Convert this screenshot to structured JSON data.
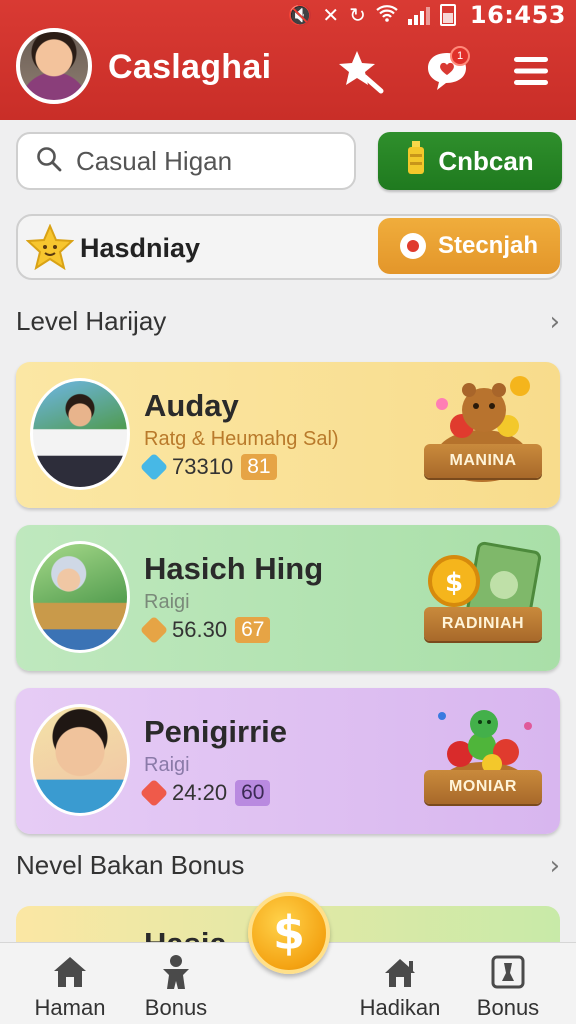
{
  "status": {
    "time": "16:453"
  },
  "header": {
    "title": "Caslaghai",
    "notification_count": "1"
  },
  "search": {
    "placeholder": "Casual Higan",
    "action_label": "Cnbcan"
  },
  "holiday": {
    "label": "Hasdniay",
    "action_label": "Stecnjah"
  },
  "sections": [
    {
      "title": "Level Harijay"
    },
    {
      "title": "Nevel Bakan Bonus"
    }
  ],
  "cards": [
    {
      "name": "Auday",
      "subtitle": "Ratg & Heumahg Sal)",
      "value": "73310",
      "tag": "81",
      "prize_label": "MANINA"
    },
    {
      "name": "Hasich Hing",
      "subtitle": "Raigi",
      "value": "56.30",
      "tag": "67",
      "prize_label": "RADINIAH"
    },
    {
      "name": "Penigirrie",
      "subtitle": "Raigi",
      "value": "24:20",
      "tag": "60",
      "prize_label": "MONIAR"
    }
  ],
  "peek_card": {
    "name": "Hasia"
  },
  "bottom_nav": [
    {
      "label": "Haman"
    },
    {
      "label": "Bonus"
    },
    {
      "label": "Hadikan"
    },
    {
      "label": "Bonus"
    }
  ],
  "coin_symbol": "$",
  "colors": {
    "header_red": "#d93a33",
    "green_button": "#2f8f2c",
    "orange_button": "#f0ad3c",
    "card_yellow": "#fbe7a4",
    "card_green": "#bfe8be",
    "card_purple": "#e6ccf5"
  },
  "icons": [
    "wifi-icon",
    "signal-icon",
    "battery-icon",
    "star-wand-icon",
    "chat-heart-icon",
    "menu-icon",
    "search-icon",
    "bottle-icon",
    "star-icon",
    "target-icon",
    "chevron-right-icon",
    "home-icon",
    "person-icon",
    "house-icon",
    "chess-icon",
    "dollar-coin-icon"
  ]
}
